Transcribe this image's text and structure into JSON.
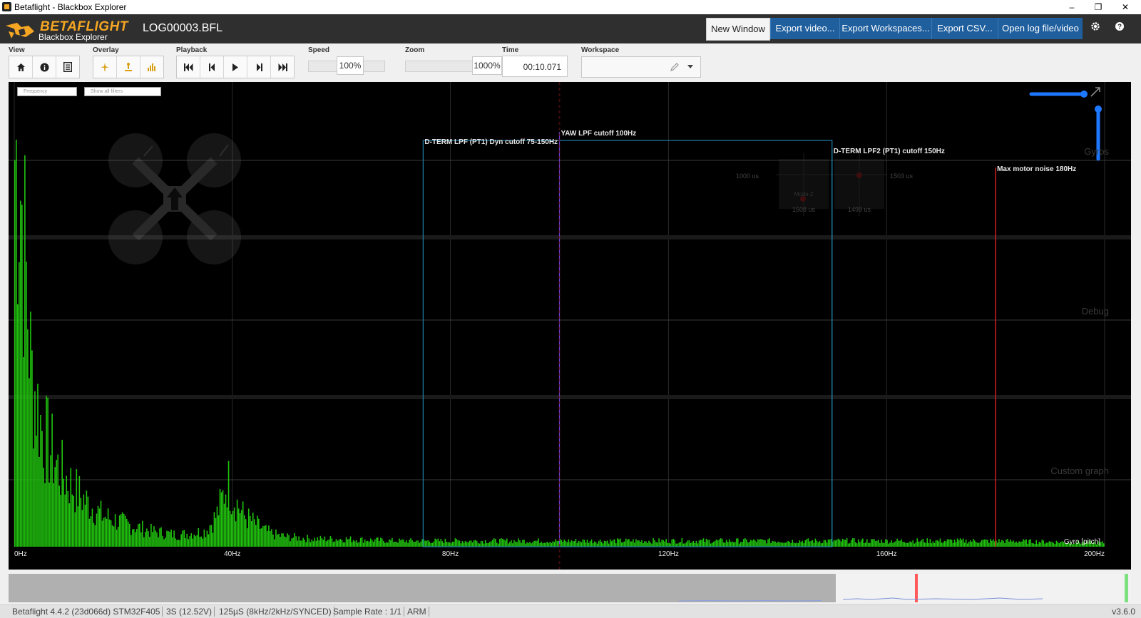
{
  "window": {
    "title": "Betaflight - Blackbox Explorer",
    "minimize": "–",
    "maximize": "❐",
    "close": "✕"
  },
  "header": {
    "logo_top": "BETAFLIGHT",
    "logo_bottom": "Blackbox Explorer",
    "filename": "LOG00003.BFL",
    "buttons": {
      "new_window": "New Window",
      "export_video": "Export video...",
      "export_workspaces": "Export Workspaces...",
      "export_csv": "Export CSV...",
      "open_log": "Open log file/video"
    },
    "icons": [
      "gear-icon",
      "help-icon"
    ]
  },
  "toolbar": {
    "view_label": "View",
    "overlay_label": "Overlay",
    "playback_label": "Playback",
    "speed_label": "Speed",
    "speed_value": "100%",
    "zoom_label": "Zoom",
    "zoom_value": "1000%",
    "time_label": "Time",
    "time_value": "00:10.071",
    "workspace_label": "Workspace"
  },
  "graph": {
    "frequency_select": "Frequency",
    "filters_select": "Show all filters",
    "x_ticks": [
      "0Hz",
      "40Hz",
      "80Hz",
      "120Hz",
      "160Hz",
      "200Hz"
    ],
    "filter_labels": {
      "dterm_lpf": "D-TERM LPF (PT1) Dyn cutoff 75-150Hz",
      "yaw_lpf": "YAW LPF cutoff 100Hz",
      "dterm_lpf2": "D-TERM LPF2 (PT1) cutoff 150Hz",
      "motor_noise": "Max motor noise 180Hz"
    },
    "group_labels": {
      "gyros": "Gyros",
      "debug": "Debug",
      "custom": "Custom graph"
    },
    "series_label": "Gyro [pitch]",
    "stick_values": {
      "left_x": "1000 us",
      "right_x": "1503 us",
      "left_y": "1508 us",
      "right_y": "1499 us",
      "mode": "Mode 2"
    },
    "colors": {
      "spectrum": "#21c40f",
      "dterm": "#1f7fa8",
      "yaw": "#6b3fd6",
      "motor": "#d11f1f"
    }
  },
  "chart_data": {
    "type": "area",
    "title": "",
    "xlabel": "",
    "ylabel": "",
    "xlim": [
      0,
      200
    ],
    "series": [
      {
        "name": "Gyro [pitch]",
        "x": [
          0,
          1,
          2,
          3,
          5,
          8,
          12,
          16,
          20,
          25,
          30,
          35,
          37,
          38,
          39,
          40,
          42,
          44,
          46,
          48,
          50,
          55,
          60,
          70,
          80,
          100,
          120,
          140,
          160,
          180,
          200
        ],
        "y": [
          1.0,
          0.95,
          0.7,
          0.45,
          0.3,
          0.2,
          0.13,
          0.08,
          0.06,
          0.04,
          0.03,
          0.04,
          0.08,
          0.12,
          0.17,
          0.13,
          0.08,
          0.06,
          0.04,
          0.03,
          0.025,
          0.02,
          0.02,
          0.015,
          0.015,
          0.015,
          0.015,
          0.015,
          0.015,
          0.015,
          0.01
        ]
      }
    ],
    "vlines": [
      {
        "name": "D-TERM LPF (PT1) Dyn cutoff 75-150Hz",
        "from": 75,
        "to": 150
      },
      {
        "name": "YAW LPF cutoff 100Hz",
        "x": 100
      },
      {
        "name": "D-TERM LPF2 (PT1) cutoff 150Hz",
        "x": 150
      },
      {
        "name": "Max motor noise 180Hz",
        "x": 180
      }
    ]
  },
  "statusbar": {
    "firmware": "Betaflight 4.4.2 (23d066d) STM32F405",
    "battery": "3S (12.52V)",
    "looptime": "125µS (8kHz/2kHz/SYNCED)",
    "sample_rate": "Sample Rate : 1/1",
    "arm": "ARM",
    "version": "v3.6.0"
  }
}
